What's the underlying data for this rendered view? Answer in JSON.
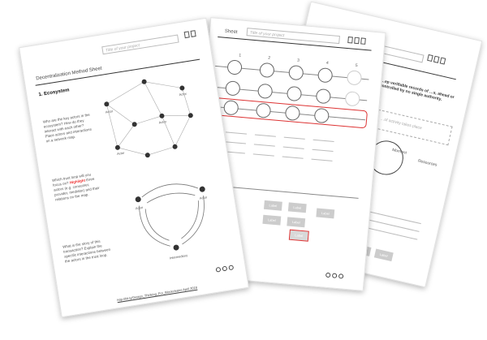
{
  "sheet1": {
    "heading": "Decentralization Method Sheet",
    "title_placeholder": "Title of your project",
    "section": "1. Ecosystem",
    "q1": "Who are the key actors in the ecosystem? How do they interact with each other? Place actors and interactions on a network map.",
    "q2_a": "Which trust loop will you focus on? ",
    "q2_highlight": "Highlight",
    "q2_b": " three actors (e.g. consumer, provider, mediator) and their relations on the map.",
    "q3": "What is the story of this transaction? Explain the specific interactions between the actors in the trust loop.",
    "actor_label": "Actor",
    "intermediary_label": "Intermediary",
    "footer": "http://bit.ly/Design_Thinking_For_Blockchains April 2018"
  },
  "sheet2": {
    "heading_fragment": "Sheet",
    "title_placeholder": "Title of your project",
    "columns": [
      "1",
      "2",
      "3",
      "4",
      "5"
    ],
    "btn_label": "Label"
  },
  "sheet3": {
    "headline": "…ep verifiable records of …s, ahead or controlled by no single authority.",
    "dashed_text": "…of activity takes place",
    "label_moment": "Moment",
    "label_resources": "Resources",
    "btn_label": "Label"
  }
}
